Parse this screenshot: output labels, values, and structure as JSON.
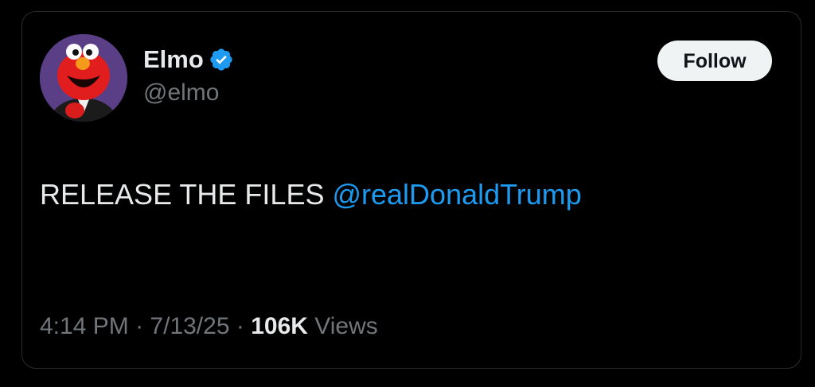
{
  "author": {
    "display_name": "Elmo",
    "handle": "@elmo",
    "verified": true,
    "avatar_icon": "elmo-avatar"
  },
  "follow_label": "Follow",
  "tweet": {
    "text": "RELEASE THE FILES",
    "mention": "@realDonaldTrump"
  },
  "meta": {
    "time": "4:14 PM",
    "sep1": "·",
    "date": "7/13/25",
    "sep2": "·",
    "views_count": "106K",
    "views_label": "Views"
  },
  "colors": {
    "background": "#000000",
    "text_primary": "#e7e9ea",
    "text_secondary": "#71767b",
    "link": "#1d9bf0",
    "verified_badge": "#1d9bf0",
    "follow_bg": "#eff3f4"
  }
}
